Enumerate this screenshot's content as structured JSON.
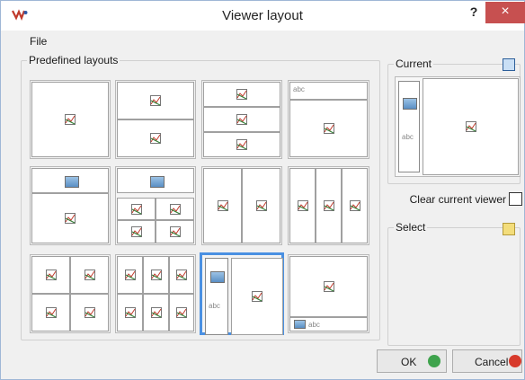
{
  "window": {
    "title": "Viewer layout",
    "help_label": "?",
    "close_label": "×"
  },
  "menu": {
    "file": "File"
  },
  "predefined": {
    "label": "Predefined layouts"
  },
  "current": {
    "label": "Current",
    "abc": "abc"
  },
  "select": {
    "label": "Select"
  },
  "clear": {
    "label": "Clear current viewer",
    "checked": false
  },
  "abc_text": "abc",
  "buttons": {
    "ok": "OK",
    "cancel": "Cancel"
  },
  "icons": {
    "app": "app-logo-icon",
    "chart": "chart-image-icon",
    "photo": "photo-thumbnail-icon",
    "save": "save-icon",
    "open": "open-folder-icon"
  },
  "colors": {
    "selected_border": "#4a90e2",
    "close_bg": "#c75050",
    "ok_green": "#3fa34d",
    "cancel_red": "#d73a2b"
  }
}
